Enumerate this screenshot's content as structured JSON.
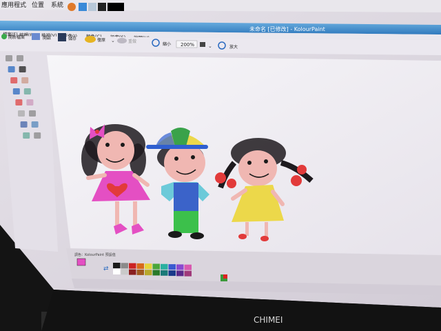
{
  "system_panel": {
    "menu_applications": "應用程式",
    "menu_places": "位置",
    "menu_system": "系統"
  },
  "window": {
    "title": "未命名 [已修改] - KolourPaint"
  },
  "menubar": {
    "items": [
      {
        "label": "檔案(F)"
      },
      {
        "label": "編輯(E)"
      },
      {
        "label": "檢視(V)"
      },
      {
        "label": "影像(I)"
      },
      {
        "label": "顏色(C)"
      },
      {
        "label": "設定(S)"
      },
      {
        "label": "說明(H)"
      }
    ]
  },
  "toolbar": {
    "new_label": "開新檔案",
    "open_label": "開啟",
    "save_label": "儲存",
    "undo_label": "復原",
    "redo_label": "重做",
    "zoom_out_label": "縮小",
    "zoom_value": "200%",
    "zoom_in_label": "放大"
  },
  "statusbar": {
    "palette_caption": "調色：KolourPaint 預設值"
  },
  "monitor": {
    "brand": "CHIMEI"
  },
  "colors": {
    "screen_bg": "#dcd7dd",
    "canvas_bg": "#ffffff",
    "titlebar_top": "#5aa3d8",
    "titlebar_bottom": "#2f79bd",
    "bezel": "#121212",
    "dress_pink": "#e44fc3",
    "dress_yellow": "#ecd84a",
    "shirt_blue": "#3b63c9",
    "pants_green": "#3cc04b",
    "skin": "#f0b7b2",
    "hair": "#1e1a1e",
    "ribbon_red": "#e23a3a",
    "cap_yellow": "#ecd84a",
    "cap_green": "#3aa24a",
    "cap_blue": "#2f5fd0",
    "heart_red": "#e23a3a"
  },
  "palette_colors": [
    "#1a1a1a",
    "#8a8a8a",
    "#c22",
    "#d86a1a",
    "#e6d43a",
    "#4aa63a",
    "#2ab0a0",
    "#3a5ad0",
    "#8a4ad0",
    "#d85ab0",
    "#ffffff",
    "#c9c9c9",
    "#8a2020",
    "#a05a20",
    "#b8a82a",
    "#2a7a2a",
    "#1a7a78",
    "#1a3a8a",
    "#5a2a8a",
    "#a03a7a"
  ]
}
